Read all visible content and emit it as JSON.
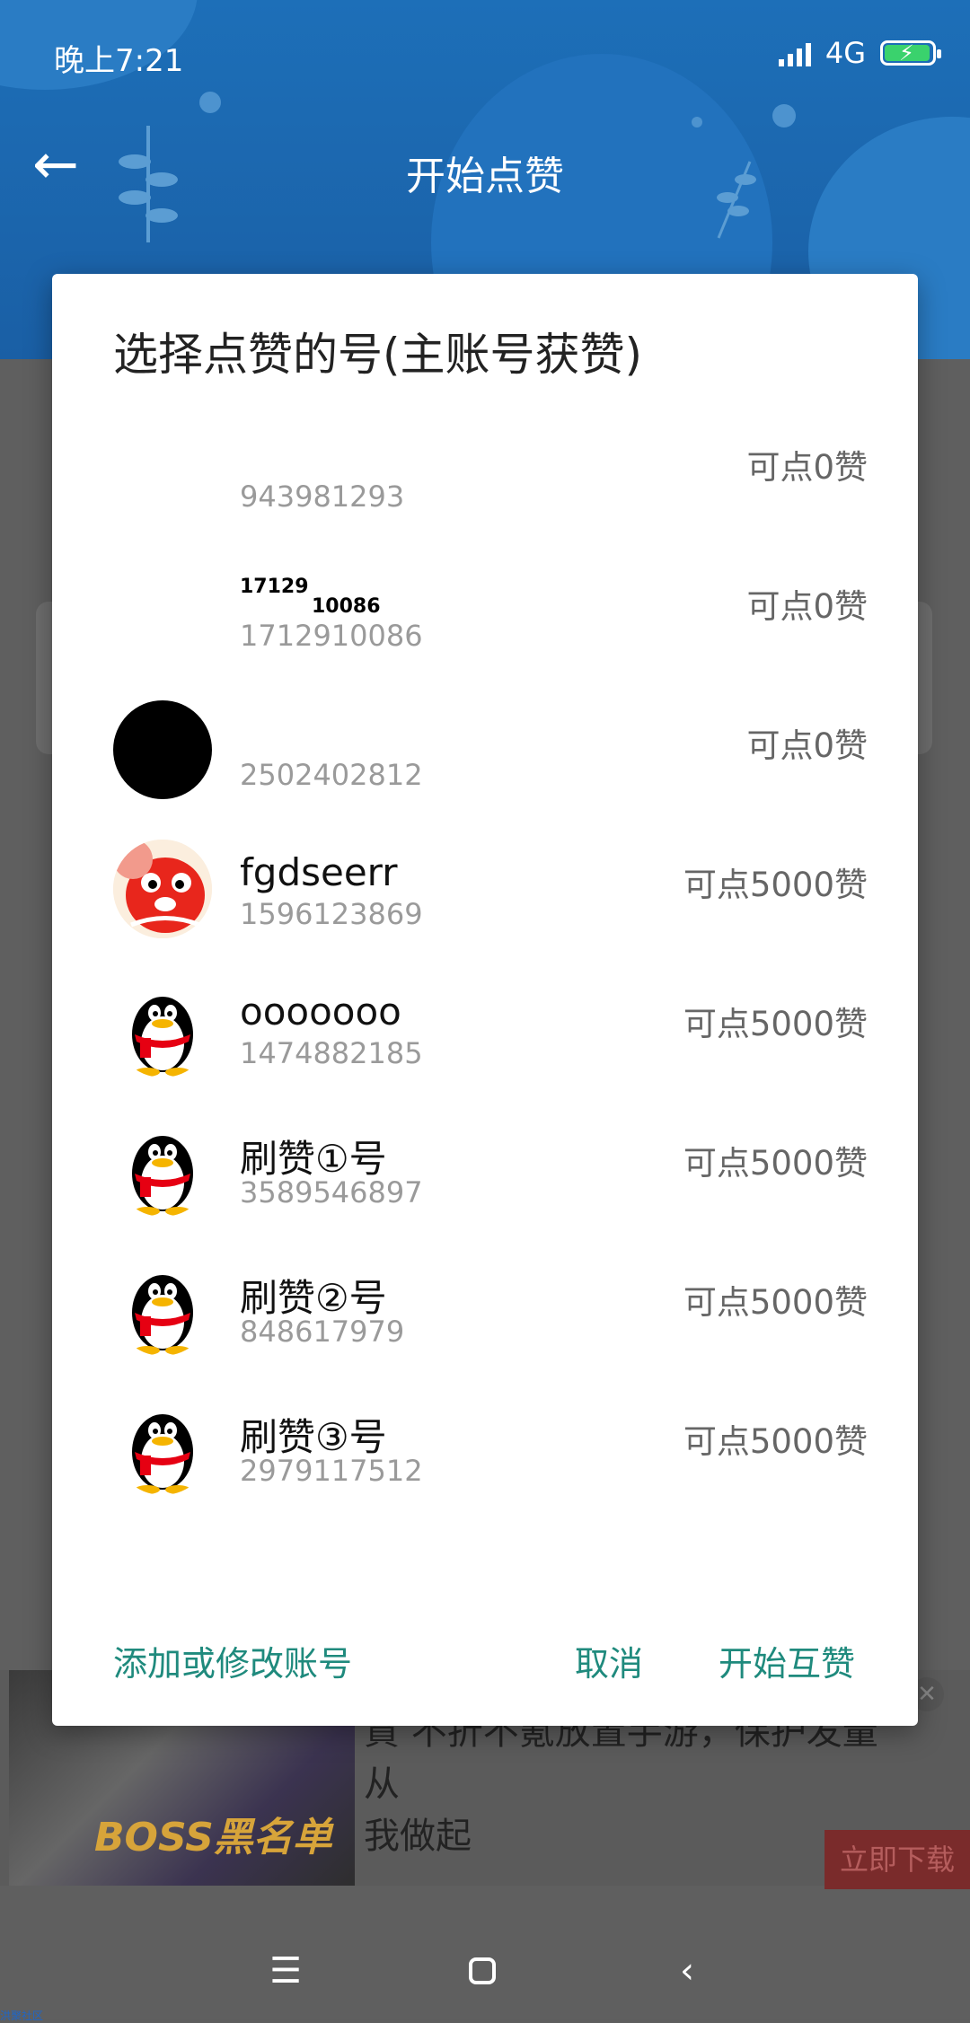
{
  "status_bar": {
    "time": "晚上7:21",
    "network": "4G"
  },
  "app_bar": {
    "title": "开始点赞"
  },
  "dialog": {
    "title": "选择点赞的号(主账号获赞)",
    "accounts": [
      {
        "name": "",
        "id": "943981293",
        "likes": "可点0赞",
        "avatar": "none"
      },
      {
        "name": "",
        "id": "1712910086",
        "likes": "可点0赞",
        "avatar": "none",
        "note_top": "17129",
        "note_bottom": "10086"
      },
      {
        "name": "",
        "id": "2502402812",
        "likes": "可点0赞",
        "avatar": "black-circle"
      },
      {
        "name": "fgdseerr",
        "id": "1596123869",
        "likes": "可点5000赞",
        "avatar": "red-mascot"
      },
      {
        "name": "ooooooo",
        "id": "1474882185",
        "likes": "可点5000赞",
        "avatar": "qq-penguin"
      },
      {
        "name": "刷赞①号",
        "id": "3589546897",
        "likes": "可点5000赞",
        "avatar": "qq-penguin"
      },
      {
        "name": "刷赞②号",
        "id": "848617979",
        "likes": "可点5000赞",
        "avatar": "qq-penguin"
      },
      {
        "name": "刷赞③号",
        "id": "2979117512",
        "likes": "可点5000赞",
        "avatar": "qq-penguin"
      }
    ],
    "actions": {
      "add_edit": "添加或修改账号",
      "cancel": "取消",
      "start": "开始互赞"
    }
  },
  "ad": {
    "text_line1": "賁 不折不氪放置手游，保护发量从",
    "text_line2": "我做起",
    "download": "立即下载",
    "logo": "BOSS黑名单"
  },
  "footer_tag": "洪聚社区",
  "colors": {
    "accent": "#1f8a7d",
    "app_bar": "#1d6fb8"
  }
}
